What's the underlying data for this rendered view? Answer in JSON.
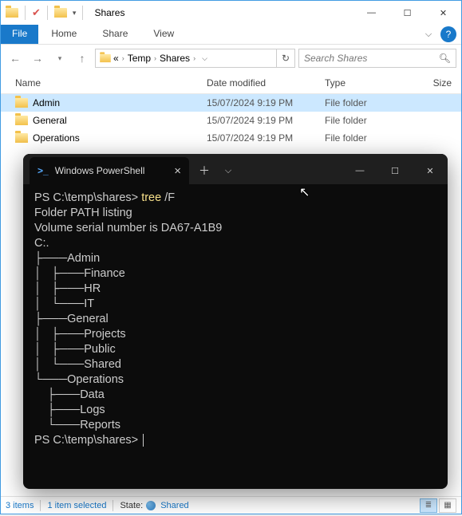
{
  "explorer": {
    "title": "Shares",
    "tabs": {
      "file": "File",
      "home": "Home",
      "share": "Share",
      "view": "View"
    },
    "address": {
      "double_chev": "«",
      "seg1": "Temp",
      "seg2": "Shares"
    },
    "search_placeholder": "Search Shares",
    "columns": {
      "name": "Name",
      "date": "Date modified",
      "type": "Type",
      "size": "Size"
    },
    "rows": [
      {
        "name": "Admin",
        "date": "15/07/2024 9:19 PM",
        "type": "File folder",
        "selected": true
      },
      {
        "name": "General",
        "date": "15/07/2024 9:19 PM",
        "type": "File folder",
        "selected": false
      },
      {
        "name": "Operations",
        "date": "15/07/2024 9:19 PM",
        "type": "File folder",
        "selected": false
      }
    ],
    "status": {
      "count": "3 items",
      "sel": "1 item selected",
      "state_lbl": "State:",
      "state_val": "Shared"
    }
  },
  "terminal": {
    "tab_title": "Windows PowerShell",
    "prompt1": "PS C:\\temp\\shares> ",
    "command": "tree",
    "args": " /F",
    "line2": "Folder PATH listing",
    "line3": "Volume serial number is DA67-A1B9",
    "line4": "C:.",
    "tree": "├───Admin\n│   ├───Finance\n│   ├───HR\n│   └───IT\n├───General\n│   ├───Projects\n│   ├───Public\n│   └───Shared\n└───Operations\n    ├───Data\n    ├───Logs\n    └───Reports",
    "prompt2": "PS C:\\temp\\shares> "
  }
}
